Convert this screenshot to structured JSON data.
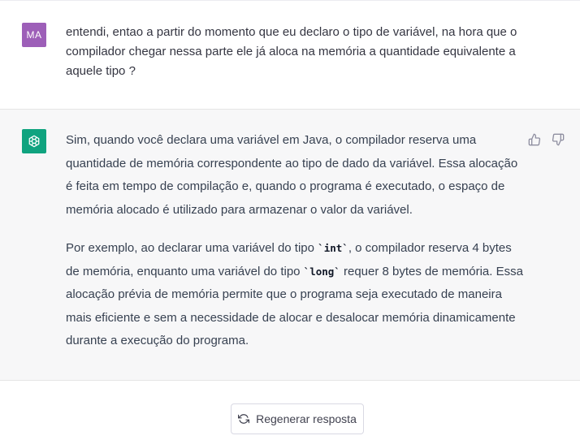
{
  "user_message": {
    "avatar_initials": "MA",
    "text": "entendi, entao a partir do momento que eu declaro o tipo de variável, na hora que o compilador chegar nessa parte ele já aloca na memória a quantidade equivalente a aquele tipo ?"
  },
  "assistant_message": {
    "avatar_icon": "openai-logo-icon",
    "paragraph_1": "Sim, quando você declara uma variável em Java, o compilador reserva uma quantidade de memória correspondente ao tipo de dado da variável. Essa alocação é feita em tempo de compilação e, quando o programa é executado, o espaço de memória alocado é utilizado para armazenar o valor da variável.",
    "paragraph_2": {
      "part_1": "Por exemplo, ao declarar uma variável do tipo ",
      "code_1": "`int`",
      "part_2": ", o compilador reserva 4 bytes de memória, enquanto uma variável do tipo ",
      "code_2": "`long`",
      "part_3": " requer 8 bytes de memória. Essa alocação prévia de memória permite que o programa seja executado de maneira mais eficiente e sem a necessidade de alocar e desalocar memória dinamicamente durante a execução do programa."
    },
    "feedback_icons": [
      "thumbs-up-icon",
      "thumbs-down-icon"
    ]
  },
  "regenerate_button": {
    "label": "Regenerar resposta",
    "icon": "refresh-icon"
  },
  "colors": {
    "user_avatar": "#9d5fb8",
    "bot_avatar": "#10a37f",
    "assistant_background": "#f7f7f8"
  }
}
